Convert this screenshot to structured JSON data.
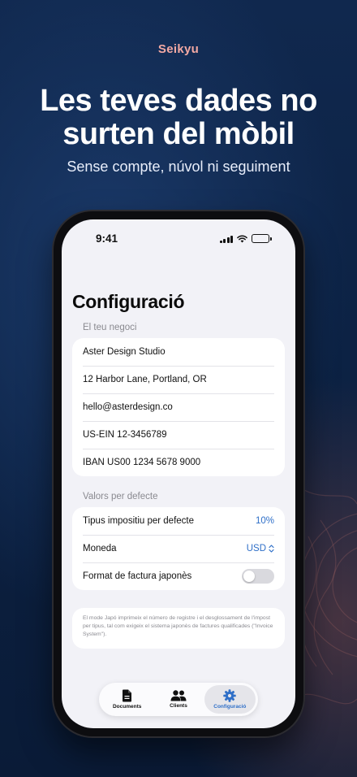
{
  "promo": {
    "brand": "Seikyu",
    "headline": "Les teves dades no surten del mòbil",
    "subline": "Sense compte, núvol ni seguiment"
  },
  "status_bar": {
    "time": "9:41",
    "icons": [
      "signal-icon",
      "wifi-icon",
      "battery-icon"
    ],
    "battery_color": "#34c759"
  },
  "screen": {
    "title": "Configuració",
    "business_section": {
      "label": "El teu negoci",
      "rows": [
        "Aster Design Studio",
        "12 Harbor Lane, Portland, OR",
        "hello@asterdesign.co",
        "US-EIN 12-3456789",
        "IBAN US00 1234 5678 9000"
      ]
    },
    "defaults_section": {
      "label": "Valors per defecte",
      "tax_label": "Tipus impositiu per defecte",
      "tax_value": "10%",
      "currency_label": "Moneda",
      "currency_value": "USD",
      "japanese_invoice_label": "Format de factura japonès",
      "japanese_invoice_enabled": false
    },
    "footnote": "El mode Japó imprimeix el número de registre i el desglossament de l'impost per tipus, tal com exigeix el sistema japonès de factures qualificades (\"Invoice System\")."
  },
  "tab_bar": {
    "active": "Configuració",
    "items": [
      {
        "label": "Documents",
        "icon": "document-icon"
      },
      {
        "label": "Clients",
        "icon": "people-icon"
      },
      {
        "label": "Configuració",
        "icon": "gear-icon"
      }
    ]
  },
  "colors": {
    "accent": "#2f6fc8",
    "brand": "#f3a9a3",
    "background": "#0c2244"
  }
}
